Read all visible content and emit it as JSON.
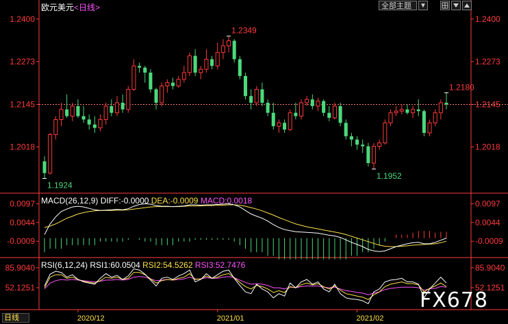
{
  "header": {
    "symbol": "欧元美元",
    "period_label": "<日线>",
    "theme_button": "全部主题",
    "theme_arrow": "▼",
    "button_icons": [
      "grid-icon",
      "arrow-down-icon",
      "arrow-up-icon"
    ]
  },
  "macd": {
    "label": "MACD(26,12,9)",
    "diff_text": "DIFF:-0.0000",
    "dea_text": "DEA:-0.0009",
    "macd_text": "MACD:0.0018",
    "ticks": [
      "0.0097",
      "0.0044",
      "-0.0009"
    ]
  },
  "rsi": {
    "label": "RSI(6,12,24)",
    "rsi1_text": "RSI1:60.0504",
    "rsi2_text": "RSI2:54.5262",
    "rsi3_text": "RSI3:52.7476",
    "ticks": [
      "85.9040",
      "52.1251"
    ]
  },
  "footer": {
    "period_button": "日线"
  },
  "watermark": "FX678",
  "colors": {
    "up": "#ff3b3b",
    "down": "#4cd97b",
    "macd_diff": "#ffffff",
    "macd_dea": "#ffe24a",
    "rsi2": "#ffe24a",
    "rsi3": "#ff55ff",
    "axis": "#ff3b3b"
  },
  "chart_data": {
    "type": "candlestick",
    "y_ticks": [
      "1.2400",
      "1.2273",
      "1.2145",
      "1.2018"
    ],
    "ylim": [
      1.188,
      1.242
    ],
    "reference_line": 1.2145,
    "x_ticks": [
      {
        "index": 6,
        "label": "2020/12"
      },
      {
        "index": 31,
        "label": "2021/01"
      },
      {
        "index": 56,
        "label": "2021/02"
      }
    ],
    "annotations": [
      {
        "index": 33,
        "value": 1.2349,
        "label": "1.2349",
        "color": "up"
      },
      {
        "index": 0,
        "value": 1.1924,
        "label": "1.1924",
        "color": "down"
      },
      {
        "index": 59,
        "value": 1.1952,
        "label": "1.1952",
        "color": "down"
      },
      {
        "index": 72,
        "value": 1.218,
        "label": "1.2180",
        "color": "up"
      }
    ],
    "candles": [
      {
        "o": 1.1975,
        "h": 1.199,
        "l": 1.1924,
        "c": 1.194
      },
      {
        "o": 1.194,
        "h": 1.206,
        "l": 1.1935,
        "c": 1.2055
      },
      {
        "o": 1.2055,
        "h": 1.211,
        "l": 1.204,
        "c": 1.21
      },
      {
        "o": 1.21,
        "h": 1.215,
        "l": 1.208,
        "c": 1.213
      },
      {
        "o": 1.213,
        "h": 1.2175,
        "l": 1.2105,
        "c": 1.211
      },
      {
        "o": 1.211,
        "h": 1.215,
        "l": 1.2095,
        "c": 1.214
      },
      {
        "o": 1.214,
        "h": 1.216,
        "l": 1.2105,
        "c": 1.211
      },
      {
        "o": 1.211,
        "h": 1.214,
        "l": 1.209,
        "c": 1.21
      },
      {
        "o": 1.21,
        "h": 1.2115,
        "l": 1.207,
        "c": 1.2085
      },
      {
        "o": 1.2085,
        "h": 1.211,
        "l": 1.206,
        "c": 1.2075
      },
      {
        "o": 1.2075,
        "h": 1.2115,
        "l": 1.2065,
        "c": 1.21
      },
      {
        "o": 1.21,
        "h": 1.215,
        "l": 1.2085,
        "c": 1.214
      },
      {
        "o": 1.214,
        "h": 1.216,
        "l": 1.211,
        "c": 1.212
      },
      {
        "o": 1.212,
        "h": 1.217,
        "l": 1.211,
        "c": 1.215
      },
      {
        "o": 1.215,
        "h": 1.2175,
        "l": 1.212,
        "c": 1.213
      },
      {
        "o": 1.213,
        "h": 1.22,
        "l": 1.212,
        "c": 1.219
      },
      {
        "o": 1.219,
        "h": 1.228,
        "l": 1.2185,
        "c": 1.226
      },
      {
        "o": 1.226,
        "h": 1.227,
        "l": 1.224,
        "c": 1.2255
      },
      {
        "o": 1.2255,
        "h": 1.226,
        "l": 1.221,
        "c": 1.224
      },
      {
        "o": 1.224,
        "h": 1.225,
        "l": 1.218,
        "c": 1.219
      },
      {
        "o": 1.219,
        "h": 1.2195,
        "l": 1.213,
        "c": 1.215
      },
      {
        "o": 1.215,
        "h": 1.221,
        "l": 1.214,
        "c": 1.22
      },
      {
        "o": 1.22,
        "h": 1.222,
        "l": 1.218,
        "c": 1.221
      },
      {
        "o": 1.221,
        "h": 1.2225,
        "l": 1.219,
        "c": 1.22
      },
      {
        "o": 1.22,
        "h": 1.223,
        "l": 1.2195,
        "c": 1.222
      },
      {
        "o": 1.222,
        "h": 1.226,
        "l": 1.221,
        "c": 1.224
      },
      {
        "o": 1.224,
        "h": 1.23,
        "l": 1.223,
        "c": 1.229
      },
      {
        "o": 1.229,
        "h": 1.231,
        "l": 1.223,
        "c": 1.224
      },
      {
        "o": 1.224,
        "h": 1.226,
        "l": 1.222,
        "c": 1.225
      },
      {
        "o": 1.225,
        "h": 1.231,
        "l": 1.224,
        "c": 1.228
      },
      {
        "o": 1.228,
        "h": 1.229,
        "l": 1.225,
        "c": 1.226
      },
      {
        "o": 1.226,
        "h": 1.233,
        "l": 1.225,
        "c": 1.23
      },
      {
        "o": 1.23,
        "h": 1.234,
        "l": 1.228,
        "c": 1.232
      },
      {
        "o": 1.232,
        "h": 1.2349,
        "l": 1.23,
        "c": 1.2335
      },
      {
        "o": 1.2335,
        "h": 1.234,
        "l": 1.227,
        "c": 1.228
      },
      {
        "o": 1.228,
        "h": 1.229,
        "l": 1.222,
        "c": 1.223
      },
      {
        "o": 1.223,
        "h": 1.224,
        "l": 1.216,
        "c": 1.217
      },
      {
        "o": 1.217,
        "h": 1.219,
        "l": 1.213,
        "c": 1.215
      },
      {
        "o": 1.215,
        "h": 1.22,
        "l": 1.214,
        "c": 1.219
      },
      {
        "o": 1.219,
        "h": 1.221,
        "l": 1.214,
        "c": 1.215
      },
      {
        "o": 1.215,
        "h": 1.216,
        "l": 1.211,
        "c": 1.212
      },
      {
        "o": 1.212,
        "h": 1.215,
        "l": 1.207,
        "c": 1.208
      },
      {
        "o": 1.208,
        "h": 1.21,
        "l": 1.206,
        "c": 1.209
      },
      {
        "o": 1.209,
        "h": 1.21,
        "l": 1.206,
        "c": 1.207
      },
      {
        "o": 1.207,
        "h": 1.213,
        "l": 1.2065,
        "c": 1.212
      },
      {
        "o": 1.212,
        "h": 1.215,
        "l": 1.21,
        "c": 1.211
      },
      {
        "o": 1.211,
        "h": 1.216,
        "l": 1.21,
        "c": 1.215
      },
      {
        "o": 1.215,
        "h": 1.217,
        "l": 1.214,
        "c": 1.216
      },
      {
        "o": 1.216,
        "h": 1.2175,
        "l": 1.213,
        "c": 1.214
      },
      {
        "o": 1.214,
        "h": 1.2165,
        "l": 1.2125,
        "c": 1.2155
      },
      {
        "o": 1.2155,
        "h": 1.216,
        "l": 1.211,
        "c": 1.212
      },
      {
        "o": 1.212,
        "h": 1.214,
        "l": 1.2095,
        "c": 1.2105
      },
      {
        "o": 1.2105,
        "h": 1.215,
        "l": 1.21,
        "c": 1.214
      },
      {
        "o": 1.214,
        "h": 1.215,
        "l": 1.208,
        "c": 1.209
      },
      {
        "o": 1.209,
        "h": 1.21,
        "l": 1.204,
        "c": 1.205
      },
      {
        "o": 1.205,
        "h": 1.206,
        "l": 1.202,
        "c": 1.204
      },
      {
        "o": 1.204,
        "h": 1.205,
        "l": 1.201,
        "c": 1.2025
      },
      {
        "o": 1.2025,
        "h": 1.204,
        "l": 1.2,
        "c": 1.202
      },
      {
        "o": 1.202,
        "h": 1.203,
        "l": 1.196,
        "c": 1.197
      },
      {
        "o": 1.197,
        "h": 1.203,
        "l": 1.1952,
        "c": 1.202
      },
      {
        "o": 1.202,
        "h": 1.204,
        "l": 1.201,
        "c": 1.203
      },
      {
        "o": 1.203,
        "h": 1.21,
        "l": 1.2025,
        "c": 1.209
      },
      {
        "o": 1.209,
        "h": 1.213,
        "l": 1.208,
        "c": 1.212
      },
      {
        "o": 1.212,
        "h": 1.214,
        "l": 1.211,
        "c": 1.2125
      },
      {
        "o": 1.2125,
        "h": 1.2145,
        "l": 1.2115,
        "c": 1.213
      },
      {
        "o": 1.213,
        "h": 1.2145,
        "l": 1.2115,
        "c": 1.212
      },
      {
        "o": 1.212,
        "h": 1.214,
        "l": 1.2105,
        "c": 1.213
      },
      {
        "o": 1.213,
        "h": 1.216,
        "l": 1.211,
        "c": 1.2125
      },
      {
        "o": 1.2125,
        "h": 1.213,
        "l": 1.205,
        "c": 1.206
      },
      {
        "o": 1.206,
        "h": 1.21,
        "l": 1.205,
        "c": 1.209
      },
      {
        "o": 1.209,
        "h": 1.213,
        "l": 1.208,
        "c": 1.212
      },
      {
        "o": 1.212,
        "h": 1.216,
        "l": 1.21,
        "c": 1.215
      },
      {
        "o": 1.215,
        "h": 1.218,
        "l": 1.213,
        "c": 1.2145
      }
    ],
    "macd_values": [
      -0.004,
      -0.003,
      -0.003,
      -0.003,
      -0.002,
      -0.002,
      -0.002,
      -0.002,
      -0.002,
      -0.002,
      -0.001,
      -0.001,
      -0.001,
      -0.001,
      -0.001,
      -0.0005,
      0.0,
      -0.0005,
      -0.001,
      -0.001,
      -0.002,
      -0.002,
      -0.002,
      -0.002,
      -0.001,
      -0.001,
      -0.001,
      -0.0005,
      -0.0005,
      -0.0005,
      -0.0005,
      -0.0005,
      -0.0005,
      -0.0005,
      -0.001,
      -0.002,
      -0.003,
      -0.004,
      -0.004,
      -0.004,
      -0.005,
      -0.005,
      -0.006,
      -0.006,
      -0.006,
      -0.006,
      -0.006,
      -0.006,
      -0.006,
      -0.006,
      -0.006,
      -0.006,
      -0.006,
      -0.006,
      -0.006,
      -0.005,
      -0.005,
      -0.004,
      -0.004,
      -0.003,
      -0.002,
      -0.001,
      0.0,
      0.001,
      0.001,
      0.001,
      0.0015,
      0.002,
      0.002,
      0.002,
      0.0015,
      0.0018,
      0.0018
    ],
    "macd_diff": [
      0.001,
      0.004,
      0.006,
      0.0075,
      0.0082,
      0.0088,
      0.009,
      0.0088,
      0.0084,
      0.008,
      0.0078,
      0.0079,
      0.008,
      0.0081,
      0.008,
      0.0083,
      0.009,
      0.0095,
      0.0097,
      0.0096,
      0.0092,
      0.009,
      0.009,
      0.0089,
      0.009,
      0.0091,
      0.0094,
      0.0094,
      0.0093,
      0.0094,
      0.0094,
      0.0095,
      0.0096,
      0.0097,
      0.0094,
      0.0088,
      0.0078,
      0.0068,
      0.0062,
      0.0056,
      0.0048,
      0.0038,
      0.003,
      0.0024,
      0.0021,
      0.0018,
      0.0017,
      0.0016,
      0.0015,
      0.0014,
      0.0011,
      0.0008,
      0.0006,
      0.0002,
      -0.0005,
      -0.0012,
      -0.0018,
      -0.0024,
      -0.0032,
      -0.0036,
      -0.0038,
      -0.0036,
      -0.003,
      -0.0024,
      -0.002,
      -0.0016,
      -0.0013,
      -0.0012,
      -0.0016,
      -0.0016,
      -0.0012,
      -0.0006,
      0.0
    ],
    "macd_dea": [
      0.003,
      0.0034,
      0.004,
      0.0048,
      0.0056,
      0.0062,
      0.0068,
      0.0072,
      0.0075,
      0.0077,
      0.0078,
      0.0078,
      0.0078,
      0.0079,
      0.0079,
      0.008,
      0.0082,
      0.0084,
      0.0086,
      0.0088,
      0.0089,
      0.0089,
      0.0089,
      0.0089,
      0.0089,
      0.009,
      0.0091,
      0.0091,
      0.0091,
      0.0092,
      0.0092,
      0.0093,
      0.0093,
      0.0094,
      0.0094,
      0.0093,
      0.009,
      0.0086,
      0.0082,
      0.0077,
      0.0071,
      0.0065,
      0.0058,
      0.0052,
      0.0046,
      0.004,
      0.0036,
      0.0032,
      0.0029,
      0.0026,
      0.0023,
      0.002,
      0.0017,
      0.0014,
      0.001,
      0.0005,
      0.0,
      -0.0005,
      -0.001,
      -0.0015,
      -0.002,
      -0.0023,
      -0.0024,
      -0.0024,
      -0.0023,
      -0.0022,
      -0.002,
      -0.0019,
      -0.0018,
      -0.0017,
      -0.0016,
      -0.0013,
      -0.0009
    ],
    "rsi1": [
      55,
      75,
      80,
      78,
      70,
      74,
      66,
      62,
      60,
      58,
      68,
      76,
      70,
      73,
      66,
      72,
      84,
      82,
      75,
      65,
      55,
      68,
      70,
      66,
      72,
      76,
      82,
      62,
      66,
      76,
      68,
      74,
      80,
      82,
      68,
      56,
      45,
      42,
      58,
      50,
      45,
      35,
      42,
      38,
      60,
      52,
      62,
      66,
      58,
      62,
      50,
      45,
      58,
      42,
      35,
      33,
      32,
      30,
      25,
      45,
      50,
      62,
      65,
      66,
      68,
      62,
      62,
      58,
      35,
      50,
      60,
      70,
      60
    ],
    "rsi2": [
      52,
      70,
      74,
      74,
      68,
      70,
      66,
      63,
      61,
      60,
      64,
      70,
      68,
      70,
      66,
      68,
      78,
      78,
      74,
      67,
      60,
      64,
      66,
      65,
      68,
      70,
      76,
      66,
      67,
      72,
      68,
      70,
      74,
      76,
      69,
      61,
      54,
      50,
      56,
      54,
      50,
      44,
      47,
      44,
      54,
      52,
      57,
      60,
      57,
      59,
      54,
      50,
      55,
      48,
      42,
      40,
      38,
      36,
      32,
      40,
      45,
      54,
      58,
      60,
      62,
      59,
      59,
      57,
      45,
      51,
      55,
      60,
      54
    ],
    "rsi3": [
      50,
      60,
      64,
      66,
      65,
      66,
      65,
      64,
      63,
      62,
      63,
      65,
      65,
      66,
      65,
      66,
      70,
      71,
      70,
      67,
      64,
      65,
      66,
      65,
      66,
      67,
      70,
      67,
      67,
      69,
      68,
      68,
      70,
      71,
      69,
      65,
      61,
      58,
      59,
      58,
      56,
      52,
      52,
      50,
      53,
      52,
      54,
      55,
      55,
      55,
      53,
      52,
      53,
      50,
      47,
      46,
      44,
      43,
      40,
      43,
      45,
      49,
      51,
      52,
      53,
      53,
      53,
      52,
      48,
      50,
      51,
      54,
      53
    ]
  }
}
